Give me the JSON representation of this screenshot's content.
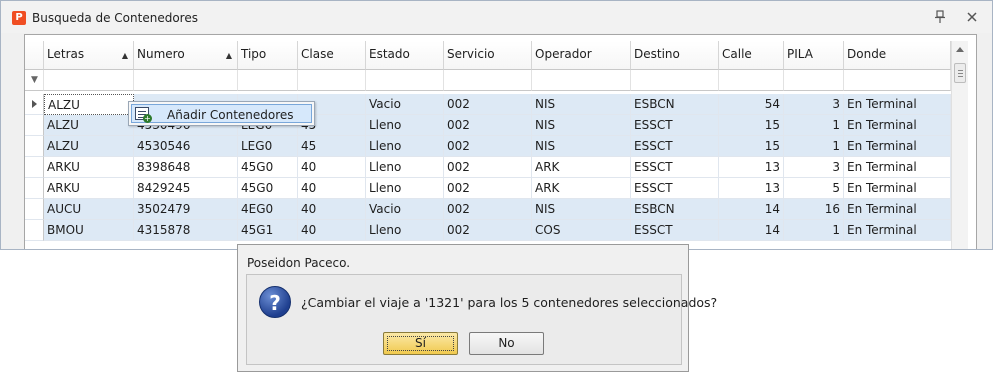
{
  "window": {
    "title": "Busqueda de Contenedores",
    "app_icon_letter": "P"
  },
  "grid": {
    "columns": [
      "Letras",
      "Numero",
      "Tipo",
      "Clase",
      "Estado",
      "Servicio",
      "Operador",
      "Destino",
      "Calle",
      "PILA",
      "Donde"
    ],
    "sorted_columns": [
      "Letras",
      "Numero"
    ],
    "rows": [
      [
        "ALZU",
        "",
        "",
        "",
        "Vacio",
        "002",
        "NIS",
        "ESBCN",
        "54",
        "3",
        "En Terminal"
      ],
      [
        "ALZU",
        "4530496",
        "LEG0",
        "45",
        "Lleno",
        "002",
        "NIS",
        "ESSCT",
        "15",
        "1",
        "En Terminal"
      ],
      [
        "ALZU",
        "4530546",
        "LEG0",
        "45",
        "Lleno",
        "002",
        "NIS",
        "ESSCT",
        "15",
        "1",
        "En Terminal"
      ],
      [
        "ARKU",
        "8398648",
        "45G0",
        "40",
        "Lleno",
        "002",
        "ARK",
        "ESSCT",
        "13",
        "3",
        "En Terminal"
      ],
      [
        "ARKU",
        "8429245",
        "45G0",
        "40",
        "Lleno",
        "002",
        "ARK",
        "ESSCT",
        "13",
        "5",
        "En Terminal"
      ],
      [
        "AUCU",
        "3502479",
        "4EG0",
        "40",
        "Vacio",
        "002",
        "NIS",
        "ESBCN",
        "14",
        "16",
        "En Terminal"
      ],
      [
        "BMOU",
        "4315878",
        "45G1",
        "40",
        "Lleno",
        "002",
        "COS",
        "ESSCT",
        "14",
        "1",
        "En Terminal"
      ]
    ],
    "selected_rows": [
      0,
      1,
      2,
      5,
      6
    ]
  },
  "context_menu": {
    "item_label": "Añadir Contenedores",
    "item_icon": "add-list-icon"
  },
  "dialog": {
    "title": "Poseidon Paceco.",
    "message": "¿Cambiar el viaje a '1321' para los 5 contenedores seleccionados?",
    "icon": "question-icon",
    "yes_label": "Sí",
    "no_label": "No"
  },
  "colors": {
    "selected_row": "#dde9f5",
    "menu_highlight": "#d6e8fb",
    "default_button": "#f0c94e",
    "app_icon": "#f04e23"
  }
}
